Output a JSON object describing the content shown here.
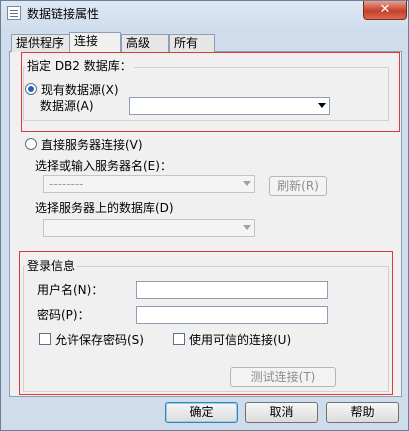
{
  "window": {
    "title": "数据链接属性",
    "close_label": "✕"
  },
  "tabs": [
    {
      "label": "提供程序",
      "active": false
    },
    {
      "label": "连接",
      "active": true
    },
    {
      "label": "高级",
      "active": false
    },
    {
      "label": "所有",
      "active": false
    }
  ],
  "db2": {
    "legend": "指定 DB2 数据库：",
    "existing_source_label": "现有数据源(X)",
    "source_label": "数据源(A)",
    "source_value": ""
  },
  "direct": {
    "option_label": "直接服务器连接(V)",
    "server_label": "选择或输入服务器名(E)：",
    "server_value": "--------",
    "refresh_label": "刷新(R)",
    "db_label": "选择服务器上的数据库(D)",
    "db_value": ""
  },
  "login": {
    "legend": "登录信息",
    "username_label": "用户名(N)：",
    "username_value": "",
    "password_label": "密码(P)：",
    "password_value": "",
    "save_password_label": "允许保存密码(S)",
    "trusted_label": "使用可信的连接(U)",
    "test_label": "测试连接(T)"
  },
  "footer": {
    "ok_label": "确定",
    "cancel_label": "取消",
    "help_label": "帮助"
  }
}
